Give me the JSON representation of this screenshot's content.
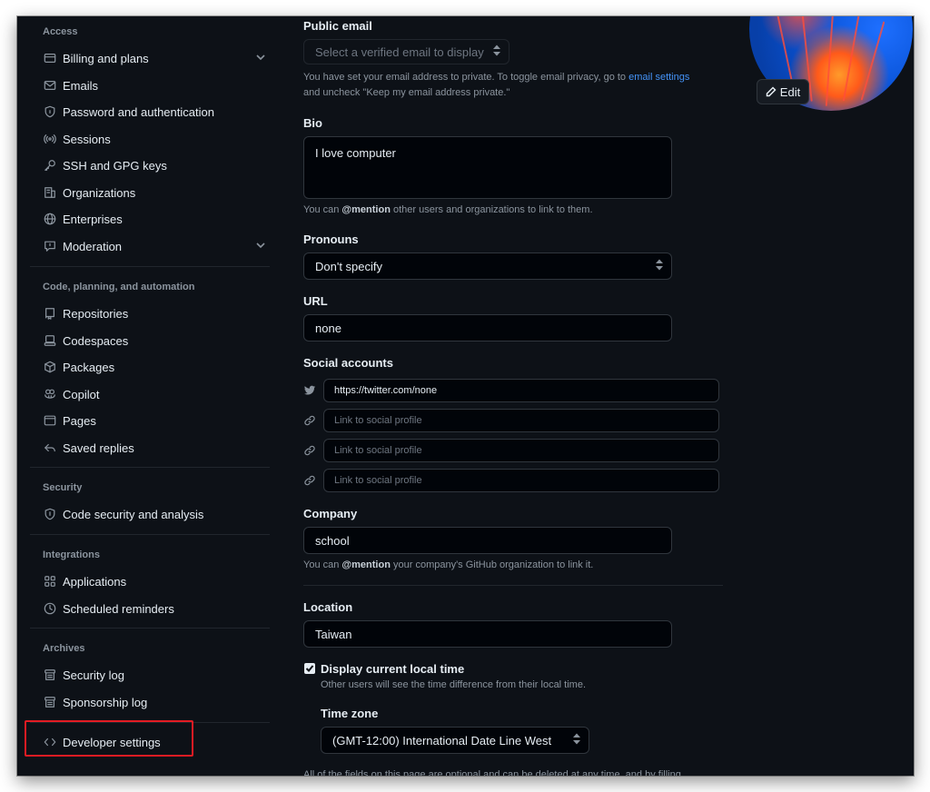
{
  "sidebar": {
    "groups": {
      "access": "Access",
      "code": "Code, planning, and automation",
      "security": "Security",
      "integrations": "Integrations",
      "archives": "Archives"
    },
    "items": {
      "billing": "Billing and plans",
      "emails": "Emails",
      "password": "Password and authentication",
      "sessions": "Sessions",
      "ssh": "SSH and GPG keys",
      "organizations": "Organizations",
      "enterprises": "Enterprises",
      "moderation": "Moderation",
      "repositories": "Repositories",
      "codespaces": "Codespaces",
      "packages": "Packages",
      "copilot": "Copilot",
      "pages": "Pages",
      "saved_replies": "Saved replies",
      "code_security": "Code security and analysis",
      "applications": "Applications",
      "scheduled_reminders": "Scheduled reminders",
      "security_log": "Security log",
      "sponsorship_log": "Sponsorship log",
      "developer_settings": "Developer settings"
    }
  },
  "profile": {
    "public_email": {
      "label": "Public email",
      "value": "Select a verified email to display",
      "note_pre": "You have set your email address to private. To toggle email privacy, go to ",
      "note_link": "email settings",
      "note_post": "and uncheck \"Keep my email address private.\""
    },
    "bio": {
      "label": "Bio",
      "value": "I love computer",
      "note_pre": "You can ",
      "note_mention": "@mention",
      "note_post": " other users and organizations to link to them."
    },
    "pronouns": {
      "label": "Pronouns",
      "value": "Don't specify"
    },
    "url": {
      "label": "URL",
      "value": "none"
    },
    "social": {
      "label": "Social accounts",
      "accounts": [
        {
          "icon": "twitter-icon",
          "value": "https://twitter.com/none",
          "placeholder": ""
        },
        {
          "icon": "link-icon",
          "value": "",
          "placeholder": "Link to social profile"
        },
        {
          "icon": "link-icon",
          "value": "",
          "placeholder": "Link to social profile"
        },
        {
          "icon": "link-icon",
          "value": "",
          "placeholder": "Link to social profile"
        }
      ]
    },
    "company": {
      "label": "Company",
      "value": "school",
      "note_pre": "You can ",
      "note_mention": "@mention",
      "note_post": " your company's GitHub organization to link it."
    },
    "location": {
      "label": "Location",
      "value": "Taiwan"
    },
    "local_time": {
      "label": "Display current local time",
      "checked": true,
      "note": "Other users will see the time difference from their local time."
    },
    "time_zone": {
      "label": "Time zone",
      "value": "(GMT-12:00) International Date Line West"
    },
    "footer_note": "All of the fields on this page are optional and can be deleted at any time, and by filling"
  },
  "avatar": {
    "edit_label": "Edit"
  },
  "colors": {
    "bg": "#0d1117",
    "border": "#30363d",
    "link": "#4493f8",
    "highlight": "#e31b23"
  }
}
